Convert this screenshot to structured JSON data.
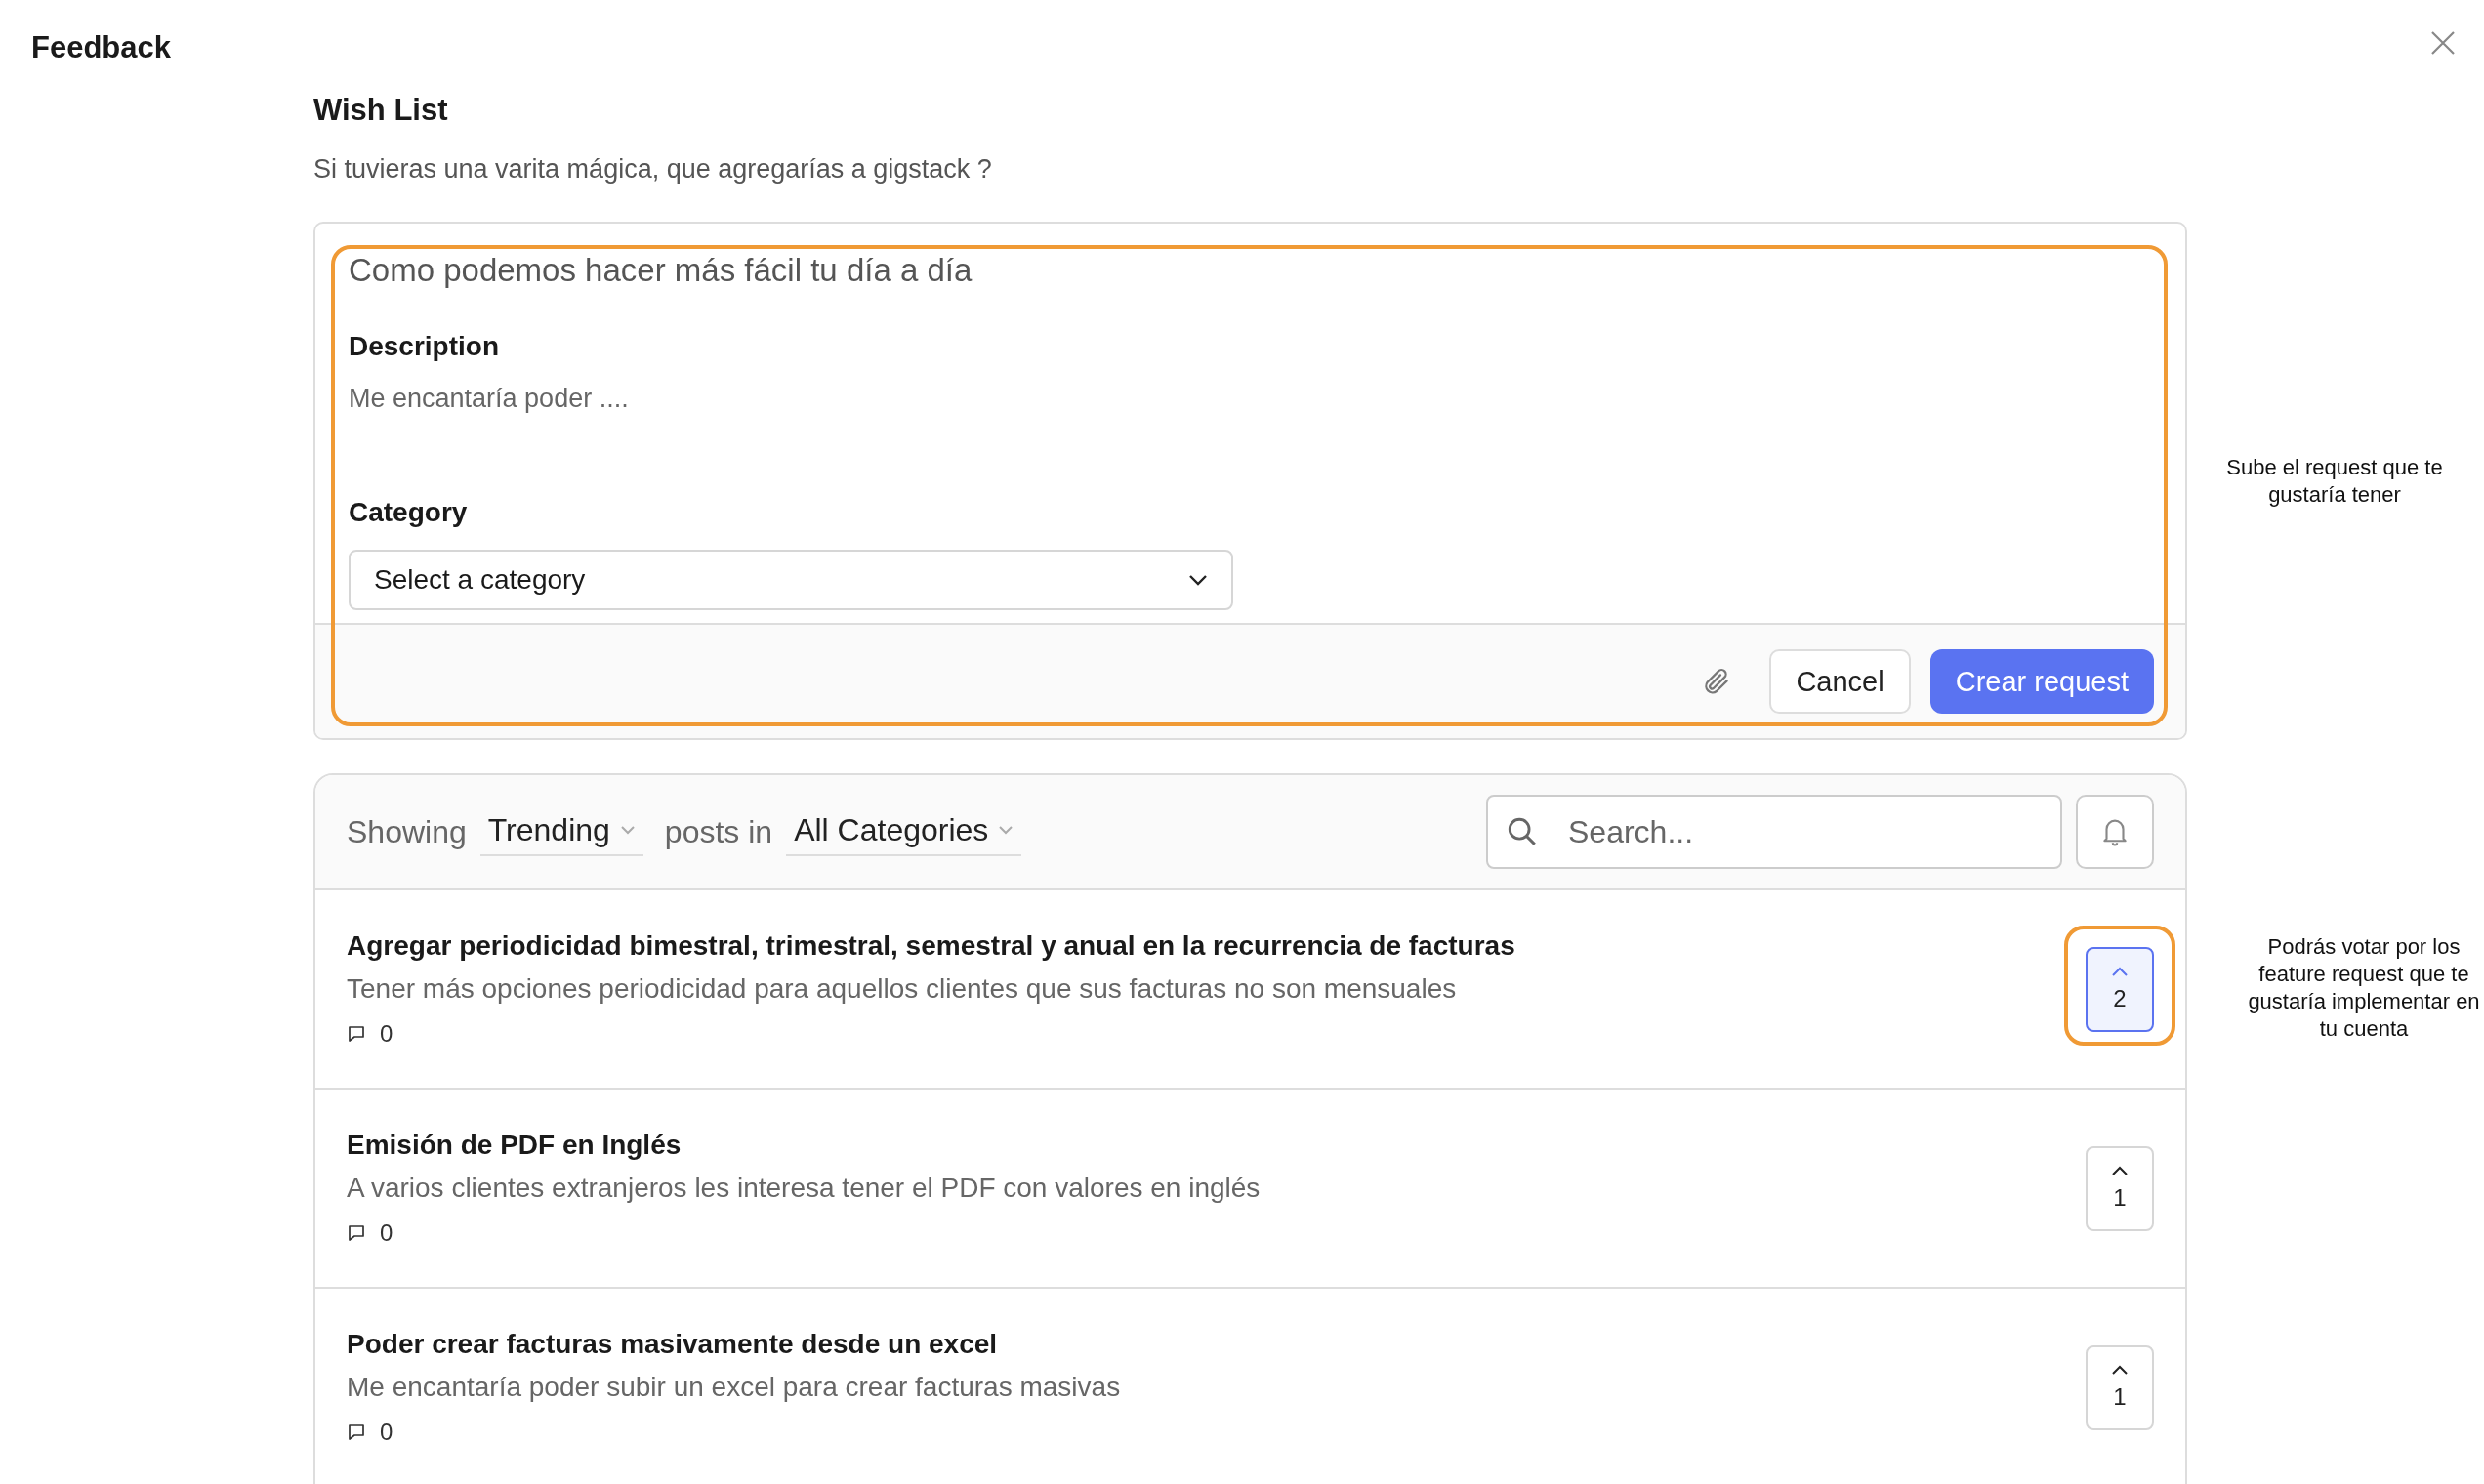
{
  "app": {
    "title": "Feedback"
  },
  "wish_list": {
    "title": "Wish List",
    "subtitle": "Si tuvieras una varita mágica, que agregarías a gigstack ?"
  },
  "form": {
    "highlighted": true,
    "title_placeholder": "Como podemos hacer más fácil tu día a día",
    "description_label": "Description",
    "description_placeholder": "Me encantaría poder ....",
    "category_label": "Category",
    "category_select": "Select a category",
    "cancel": "Cancel",
    "submit": "Crear request"
  },
  "notes": [
    "Sube el request que te gustaría tener",
    "Podrás votar por los feature request que te gustaría implementar en tu cuenta"
  ],
  "filter": {
    "showing": "Showing",
    "sort": "Trending",
    "posts_in": "posts in",
    "category": "All Categories",
    "search_placeholder": "Search..."
  },
  "posts": [
    {
      "title": "Agregar periodicidad bimestral, trimestral, semestral y anual en la recurrencia de facturas",
      "description": "Tener más opciones periodicidad para aquellos clientes que sus facturas no son mensuales",
      "comments": "0",
      "votes": "2",
      "voted": true,
      "highlighted": true
    },
    {
      "title": "Emisión de PDF en Inglés",
      "description": "A varios clientes extranjeros les interesa tener el PDF con valores en inglés",
      "comments": "0",
      "votes": "1",
      "voted": false,
      "highlighted": false
    },
    {
      "title": "Poder crear facturas masivamente desde un excel",
      "description": "Me encantaría poder subir un excel para crear facturas masivas",
      "comments": "0",
      "votes": "1",
      "voted": false,
      "highlighted": false
    }
  ]
}
